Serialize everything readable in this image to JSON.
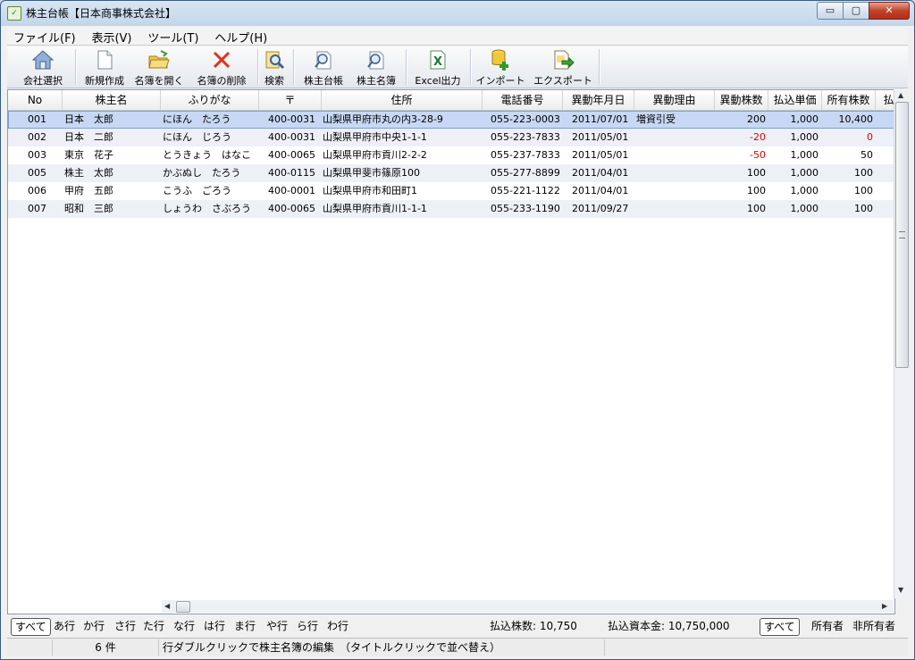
{
  "window": {
    "title": "株主台帳【日本商事株式会社】",
    "controls": [
      "▭",
      "▢",
      "✕"
    ]
  },
  "menu": [
    {
      "label": "ファイル(F)"
    },
    {
      "label": "表示(V)"
    },
    {
      "label": "ツール(T)"
    },
    {
      "label": "ヘルプ(H)"
    }
  ],
  "toolbar": [
    {
      "label": "会社選択",
      "icon": "house-icon"
    },
    {
      "label": "新規作成",
      "icon": "new-document-icon"
    },
    {
      "label": "名簿を開く",
      "icon": "open-folder-icon"
    },
    {
      "label": "名簿の削除",
      "icon": "delete-x-icon"
    },
    {
      "label": "検索",
      "icon": "search-icon"
    },
    {
      "label": "株主台帳",
      "icon": "magnifier-document-icon"
    },
    {
      "label": "株主名簿",
      "icon": "magnifier-document-icon"
    },
    {
      "label": "Excel出力",
      "icon": "excel-icon"
    },
    {
      "label": "インポート",
      "icon": "database-add-icon"
    },
    {
      "label": "エクスポート",
      "icon": "export-icon"
    }
  ],
  "table": {
    "columns": [
      "No",
      "株主名",
      "ふりがな",
      "〒",
      "住所",
      "電話番号",
      "異動年月日",
      "異動理由",
      "異動株数",
      "払込単価",
      "所有株数",
      "払"
    ],
    "rows": [
      {
        "no": "001",
        "name": "日本　太郎",
        "kana": "にほん　たろう",
        "zip": "400-0031",
        "address": "山梨県甲府市丸の内3-28-9",
        "phone": "055-223-0003",
        "date": "2011/07/01",
        "reason": "増資引受",
        "change": "200",
        "price": "1,000",
        "owned": "10,400"
      },
      {
        "no": "002",
        "name": "日本　二郎",
        "kana": "にほん　じろう",
        "zip": "400-0031",
        "address": "山梨県甲府市中央1-1-1",
        "phone": "055-223-7833",
        "date": "2011/05/01",
        "reason": "",
        "change": "-20",
        "price": "1,000",
        "owned": "0"
      },
      {
        "no": "003",
        "name": "東京　花子",
        "kana": "とうきょう　はなこ",
        "zip": "400-0065",
        "address": "山梨県甲府市貢川2-2-2",
        "phone": "055-237-7833",
        "date": "2011/05/01",
        "reason": "",
        "change": "-50",
        "price": "1,000",
        "owned": "50"
      },
      {
        "no": "005",
        "name": "株主　太郎",
        "kana": "かぶぬし　たろう",
        "zip": "400-0115",
        "address": "山梨県甲斐市篠原100",
        "phone": "055-277-8899",
        "date": "2011/04/01",
        "reason": "",
        "change": "100",
        "price": "1,000",
        "owned": "100"
      },
      {
        "no": "006",
        "name": "甲府　五郎",
        "kana": "こうふ　ごろう",
        "zip": "400-0001",
        "address": "山梨県甲府市和田町1",
        "phone": "055-221-1122",
        "date": "2011/04/01",
        "reason": "",
        "change": "100",
        "price": "1,000",
        "owned": "100"
      },
      {
        "no": "007",
        "name": "昭和　三郎",
        "kana": "しょうわ　さぶろう",
        "zip": "400-0065",
        "address": "山梨県甲府市貢川1-1-1",
        "phone": "055-233-1190",
        "date": "2011/09/27",
        "reason": "",
        "change": "100",
        "price": "1,000",
        "owned": "100"
      }
    ]
  },
  "filter": {
    "tabs": [
      "すべて",
      "あ行",
      "か行",
      "さ行",
      "た行",
      "な行",
      "は行",
      "ま行",
      "や行",
      "ら行",
      "わ行"
    ],
    "paid_shares": "払込株数:  10,750",
    "paid_capital": "払込資本金:  10,750,000",
    "owner_tabs": [
      "すべて",
      "所有者",
      "非所有者"
    ]
  },
  "status": {
    "count": "6 件",
    "hint": "行ダブルクリックで株主名簿の編集　（タイトルクリックで並べ替え）"
  }
}
